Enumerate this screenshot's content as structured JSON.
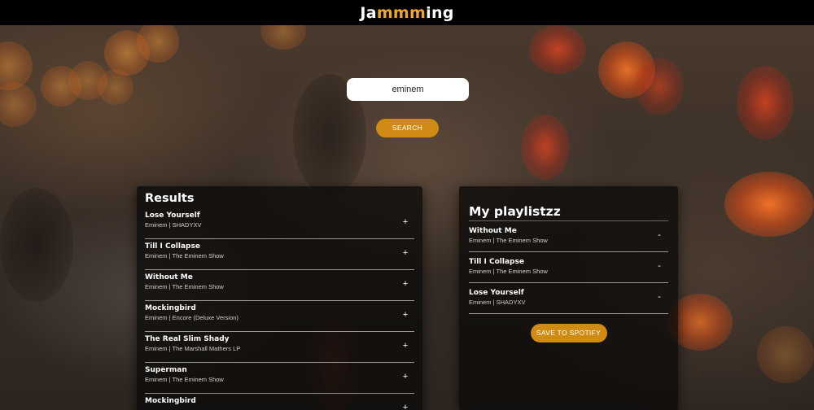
{
  "app": {
    "logo_part1": "Ja",
    "logo_accent": "mmm",
    "logo_part2": "ing"
  },
  "colors": {
    "accent": "#f2a52d",
    "button": "#cf8b14",
    "topbar": "#000000"
  },
  "search": {
    "value": "eminem",
    "button_label": "SEARCH"
  },
  "results": {
    "title": "Results",
    "add_symbol": "+",
    "tracks": [
      {
        "name": "Lose Yourself",
        "info": "Eminem | SHADYXV"
      },
      {
        "name": "Till I Collapse",
        "info": "Eminem | The Eminem Show"
      },
      {
        "name": "Without Me",
        "info": "Eminem | The Eminem Show"
      },
      {
        "name": "Mockingbird",
        "info": "Eminem | Encore (Deluxe Version)"
      },
      {
        "name": "The Real Slim Shady",
        "info": "Eminem | The Marshall Mathers LP"
      },
      {
        "name": "Superman",
        "info": "Eminem | The Eminem Show"
      },
      {
        "name": "Mockingbird",
        "info": ""
      }
    ]
  },
  "playlist": {
    "title": "My playlistzz",
    "remove_symbol": "-",
    "tracks": [
      {
        "name": "Without Me",
        "info": "Eminem | The Eminem Show"
      },
      {
        "name": "Till I Collapse",
        "info": "Eminem | The Eminem Show"
      },
      {
        "name": "Lose Yourself",
        "info": "Eminem | SHADYXV"
      }
    ],
    "save_label": "SAVE TO SPOTIFY"
  }
}
